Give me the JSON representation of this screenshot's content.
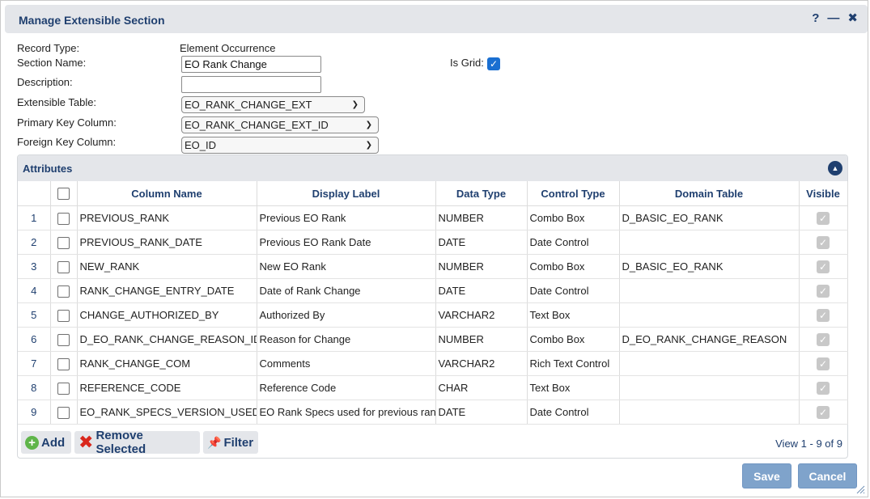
{
  "dialog": {
    "title": "Manage Extensible Section",
    "help_icon": "?",
    "minimize_icon": "—",
    "close_icon": "✖"
  },
  "form": {
    "record_type_label": "Record Type:",
    "record_type_value": "Element Occurrence",
    "section_name_label": "Section Name:",
    "section_name_value": "EO Rank Change",
    "description_label": "Description:",
    "description_value": "",
    "is_grid_label": "Is Grid:",
    "is_grid_checked": true,
    "extensible_table_label": "Extensible Table:",
    "extensible_table_value": "EO_RANK_CHANGE_EXT",
    "primary_key_label": "Primary Key Column:",
    "primary_key_value": "EO_RANK_CHANGE_EXT_ID",
    "foreign_key_label": "Foreign Key Column:",
    "foreign_key_value": "EO_ID"
  },
  "attributes": {
    "title": "Attributes",
    "columns": [
      "Column Name",
      "Display Label",
      "Data Type",
      "Control Type",
      "Domain Table",
      "Visible"
    ],
    "rows": [
      {
        "n": "1",
        "column": "PREVIOUS_RANK",
        "label": "Previous EO Rank",
        "type": "NUMBER",
        "control": "Combo Box",
        "domain": "D_BASIC_EO_RANK"
      },
      {
        "n": "2",
        "column": "PREVIOUS_RANK_DATE",
        "label": "Previous EO Rank Date",
        "type": "DATE",
        "control": "Date Control",
        "domain": ""
      },
      {
        "n": "3",
        "column": "NEW_RANK",
        "label": "New EO Rank",
        "type": "NUMBER",
        "control": "Combo Box",
        "domain": "D_BASIC_EO_RANK"
      },
      {
        "n": "4",
        "column": "RANK_CHANGE_ENTRY_DATE",
        "label": "Date of Rank Change",
        "type": "DATE",
        "control": "Date Control",
        "domain": ""
      },
      {
        "n": "5",
        "column": "CHANGE_AUTHORIZED_BY",
        "label": "Authorized By",
        "type": "VARCHAR2",
        "control": "Text Box",
        "domain": ""
      },
      {
        "n": "6",
        "column": "D_EO_RANK_CHANGE_REASON_ID",
        "label": "Reason for Change",
        "type": "NUMBER",
        "control": "Combo Box",
        "domain": "D_EO_RANK_CHANGE_REASON"
      },
      {
        "n": "7",
        "column": "RANK_CHANGE_COM",
        "label": "Comments",
        "type": "VARCHAR2",
        "control": "Rich Text Control",
        "domain": ""
      },
      {
        "n": "8",
        "column": "REFERENCE_CODE",
        "label": "Reference Code",
        "type": "CHAR",
        "control": "Text Box",
        "domain": ""
      },
      {
        "n": "9",
        "column": "EO_RANK_SPECS_VERSION_USED",
        "label": "EO Rank Specs used for previous ranl",
        "type": "DATE",
        "control": "Date Control",
        "domain": ""
      }
    ],
    "add_label": "Add",
    "remove_label": "Remove Selected",
    "filter_label": "Filter",
    "view_text": "View 1 - 9 of 9"
  },
  "buttons": {
    "save": "Save",
    "cancel": "Cancel"
  }
}
